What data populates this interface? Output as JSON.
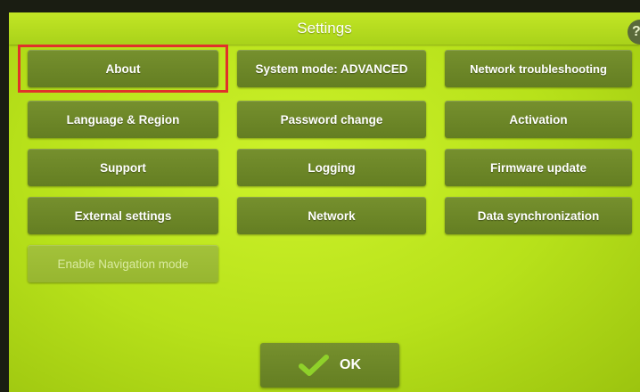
{
  "header": {
    "title": "Settings",
    "help_label": "?"
  },
  "buttons": {
    "about": "About",
    "system_mode": "System mode:  ADVANCED",
    "network_troubleshooting": "Network troubleshooting",
    "language_region": "Language & Region",
    "password_change": "Password change",
    "activation": "Activation",
    "support": "Support",
    "logging": "Logging",
    "firmware_update": "Firmware update",
    "external_settings": "External settings",
    "network": "Network",
    "data_synchronization": "Data synchronization",
    "enable_navigation_mode": "Enable Navigation mode"
  },
  "footer": {
    "ok_label": "OK",
    "ok_icon": "check-icon"
  },
  "colors": {
    "screen": "#b7e11a",
    "button": "#6b8628",
    "highlight": "#e0322a",
    "check": "#8fd12a"
  }
}
